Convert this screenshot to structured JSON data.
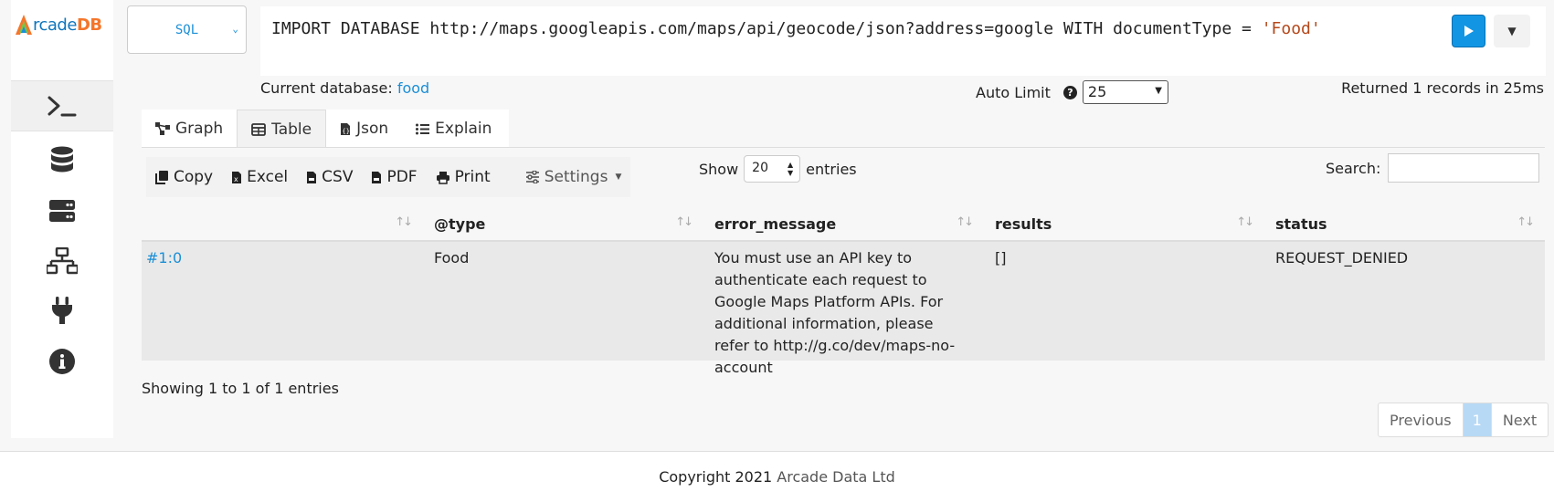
{
  "logo": {
    "text_a": "rcade",
    "text_b": "DB"
  },
  "sidebar": {
    "items": [
      {
        "icon": "terminal-icon",
        "active": true
      },
      {
        "icon": "database-icon",
        "active": false
      },
      {
        "icon": "server-icon",
        "active": false
      },
      {
        "icon": "network-icon",
        "active": false
      },
      {
        "icon": "plug-icon",
        "active": false
      },
      {
        "icon": "info-icon",
        "active": false
      }
    ]
  },
  "query": {
    "language": "SQL",
    "text": "IMPORT DATABASE http://maps.googleapis.com/maps/api/geocode/json?address=google WITH documentType = ",
    "string_literal": "'Food'"
  },
  "status": {
    "current_db_label": "Current database:",
    "current_db": "food",
    "auto_limit_label": "Auto Limit",
    "auto_limit_value": "25",
    "returned": "Returned 1 records in 25ms"
  },
  "tabs": [
    {
      "label": "Graph",
      "icon": "graph-icon"
    },
    {
      "label": "Table",
      "icon": "table-icon",
      "active": true
    },
    {
      "label": "Json",
      "icon": "json-file-icon"
    },
    {
      "label": "Explain",
      "icon": "list-icon"
    }
  ],
  "toolbar": {
    "copy": "Copy",
    "excel": "Excel",
    "csv": "CSV",
    "pdf": "PDF",
    "print": "Print",
    "settings": "Settings"
  },
  "entries": {
    "show_label": "Show",
    "value": "20",
    "entries_label": "entries"
  },
  "search": {
    "label": "Search:"
  },
  "table": {
    "columns": [
      "",
      "@type",
      "error_message",
      "results",
      "status"
    ],
    "rows": [
      {
        "rid": "#1:0",
        "type": "Food",
        "error_message": "You must use an API key to authenticate each request to Google Maps Platform APIs. For additional information, please refer to http://g.co/dev/maps-no-account",
        "results": "[]",
        "status": "REQUEST_DENIED"
      }
    ]
  },
  "info": "Showing 1 to 1 of 1 entries",
  "pager": {
    "previous": "Previous",
    "current": "1",
    "next": "Next"
  },
  "footer": {
    "prefix": "Copyright 2021 ",
    "company": "Arcade Data Ltd"
  },
  "colors": {
    "accent": "#1b8fd6",
    "brand_orange": "#f4762b",
    "row_bg": "#e9e9e9",
    "run_button": "#1296e4"
  }
}
